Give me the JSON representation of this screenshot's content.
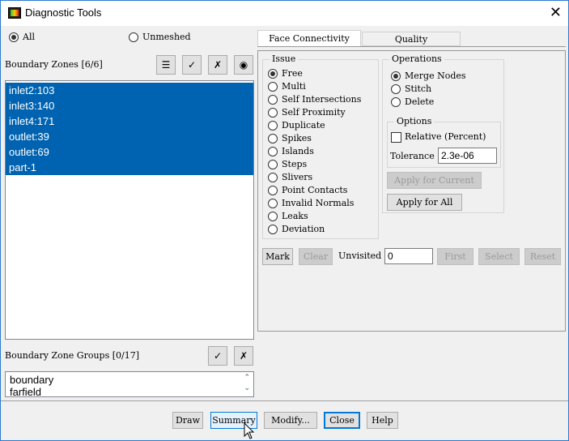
{
  "window": {
    "title": "Diagnostic Tools",
    "close": "✕"
  },
  "filter": {
    "all": "All",
    "unmeshed": "Unmeshed"
  },
  "zones": {
    "label": "Boundary Zones [6/6]",
    "items": [
      "inlet2:103",
      "inlet3:140",
      "inlet4:171",
      "outlet:39",
      "outlet:69",
      "part-1"
    ]
  },
  "groups": {
    "label": "Boundary Zone Groups [0/17]",
    "items": [
      "boundary",
      "farfield"
    ]
  },
  "tabs": [
    "Face Connectivity",
    "Quality"
  ],
  "issue": {
    "label": "Issue",
    "items": [
      "Free",
      "Multi",
      "Self Intersections",
      "Self Proximity",
      "Duplicate",
      "Spikes",
      "Islands",
      "Steps",
      "Slivers",
      "Point Contacts",
      "Invalid Normals",
      "Leaks",
      "Deviation"
    ]
  },
  "operations": {
    "label": "Operations",
    "items": [
      "Merge Nodes",
      "Stitch",
      "Delete"
    ]
  },
  "options": {
    "label": "Options",
    "relative": "Relative (Percent)",
    "tolerance_label": "Tolerance",
    "tolerance": "2.3e-06"
  },
  "apply_current": "Apply for Current",
  "apply_all": "Apply for All",
  "mark_row": {
    "mark": "Mark",
    "clear": "Clear",
    "unvisited": "Unvisited",
    "unvisited_value": "0",
    "first": "First",
    "select": "Select",
    "reset": "Reset"
  },
  "footer": {
    "draw": "Draw",
    "summary": "Summary",
    "modify": "Modify...",
    "close": "Close",
    "help": "Help"
  }
}
